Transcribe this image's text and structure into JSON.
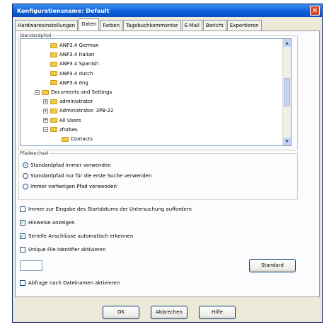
{
  "window": {
    "title": "Konfigurationsname: Default",
    "close_label": "✕"
  },
  "tabs": [
    {
      "label": "Hardwareeinstellungen"
    },
    {
      "label": "Daten"
    },
    {
      "label": "Farben"
    },
    {
      "label": "Tagebuchkommentar"
    },
    {
      "label": "E-Mail"
    },
    {
      "label": "Bericht"
    },
    {
      "label": "Exportieren"
    }
  ],
  "standard_path": {
    "legend": "Standardpfad",
    "tree": [
      {
        "label": "ANP3.4 German",
        "level": 2,
        "expander": ""
      },
      {
        "label": "ANP3.4 Italian",
        "level": 2,
        "expander": ""
      },
      {
        "label": "ANP3.4 Spanish",
        "level": 2,
        "expander": ""
      },
      {
        "label": "ANP3.4 dutch",
        "level": 2,
        "expander": ""
      },
      {
        "label": "ANP3.4 eng",
        "level": 2,
        "expander": ""
      },
      {
        "label": "Documents and Settings",
        "level": 1,
        "expander": "−"
      },
      {
        "label": "administrator",
        "level": 2,
        "expander": "+"
      },
      {
        "label": "Administrator. 3PB-22",
        "level": 2,
        "expander": "+"
      },
      {
        "label": "All Users",
        "level": 2,
        "expander": "+"
      },
      {
        "label": "zforbes",
        "level": 2,
        "expander": "−"
      },
      {
        "label": "Contacts",
        "level": 3,
        "expander": ""
      }
    ]
  },
  "path_choice": {
    "legend": "Pfadwechsel",
    "options": [
      {
        "label": "Standardpfad immer verwenden",
        "selected": true
      },
      {
        "label": "Standardpfad nur für die erste Suche verwenden",
        "selected": false
      },
      {
        "label": "Immer vorherigen Pfad verwenden",
        "selected": false
      }
    ]
  },
  "checkboxes": [
    {
      "label": "Immer zur Eingabe des Startdatums der Untersuchung auffordern",
      "checked": false
    },
    {
      "label": "Hinweise anzeigen",
      "checked": true
    },
    {
      "label": "Serielle Anschlüsse automatisch erkennen",
      "checked": true
    },
    {
      "label": "Unique File Identifier aktivieren",
      "checked": false
    }
  ],
  "unique_id_value": "",
  "standard_button": "Standard",
  "filename_checkbox": {
    "label": "Abfrage nach Dateinamen aktivieren",
    "checked": false
  },
  "footer": {
    "ok": "OK",
    "cancel": "Abbrechen",
    "help": "Hilfe"
  },
  "colors": {
    "titlebar": "#0b5fd8",
    "close": "#d44b2a",
    "panel": "#fcfcfe",
    "window": "#ece9d8"
  }
}
